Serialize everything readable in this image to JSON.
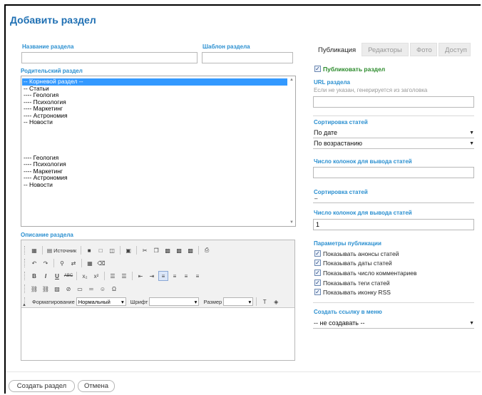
{
  "page": {
    "title": "Добавить раздел"
  },
  "form": {
    "section_name_label": "Название раздела",
    "section_name_value": "",
    "template_label": "Шаблон раздела",
    "template_value": "",
    "parent_label": "Родительский раздел",
    "parent_options": [
      "-- Корневой раздел --",
      "-- Статьи",
      "---- Геология",
      "---- Психология",
      "---- Маркетинг",
      "---- Астрономия",
      "-- Новости"
    ],
    "parent_options_repeat": [
      "---- Геология",
      "---- Психология",
      "---- Маркетинг",
      "---- Астрономия",
      "-- Новости"
    ],
    "description_label": "Описание раздела"
  },
  "editor": {
    "source_label": "Источник",
    "format_label": "Форматирование",
    "format_value": "Нормальный",
    "font_label": "Шрифт",
    "font_value": "",
    "size_label": "Размер",
    "size_value": ""
  },
  "tabs": [
    "Публикация",
    "Редакторы",
    "Фото",
    "Доступ"
  ],
  "publish": {
    "publish_checkbox_label": "Публиковать раздел",
    "url_label": "URL раздела",
    "url_hint": "Если не указан, генерируется из заголовка",
    "url_value": "",
    "sort_label": "Сортировка статей",
    "sort_by_value": "По дате",
    "sort_order_value": "По возрастанию",
    "columns_label": "Число колонок для вывода статей",
    "columns_value": "",
    "sort_label_2": "Сортировка статей",
    "sort_value_2": "–",
    "columns_label_2": "Число колонок для вывода статей",
    "columns_value_2": "1",
    "params_label": "Параметры публикации",
    "params": [
      "Показывать анонсы статей",
      "Показывать даты статей",
      "Показывать число комментариев",
      "Показывать теги статей",
      "Показывать иконку RSS"
    ],
    "menu_label": "Создать ссылку в меню",
    "menu_value": "-- не создавать --"
  },
  "buttons": {
    "create": "Создать раздел",
    "cancel": "Отмена"
  }
}
